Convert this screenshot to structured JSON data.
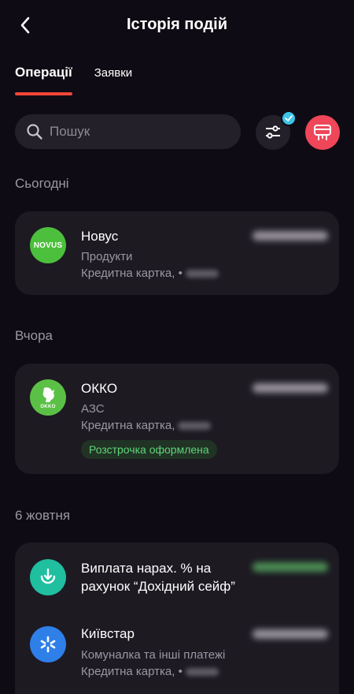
{
  "header": {
    "title": "Історія подій"
  },
  "tabs": [
    {
      "label": "Операції",
      "active": true
    },
    {
      "label": "Заявки",
      "active": false
    }
  ],
  "search": {
    "placeholder": "Пошук"
  },
  "colors": {
    "accent": "#f2473a",
    "background": "#0f0b14",
    "card": "#1d1a22",
    "check": "#3cc3e8",
    "report": "#ef4659",
    "success": "#5fd47a"
  },
  "sections": [
    {
      "label": "Сьогодні",
      "operations": [
        {
          "logo_text": "NOVUS",
          "title": "Новус",
          "category": "Продукти",
          "payment": "Кредитна картка, •",
          "logo_color": "#4cbf3c"
        }
      ]
    },
    {
      "label": "Вчора",
      "operations": [
        {
          "logo_text": "OKKO",
          "title": "ОККО",
          "category": "АЗС",
          "payment": "Кредитна картка,",
          "badge": "Розстрочка оформлена",
          "logo_color": "#5bc146"
        }
      ]
    },
    {
      "label": "6 жовтня",
      "operations": [
        {
          "title": "Виплата нарах. % на рахунок “Дохідний сейф”",
          "icon": "download-icon",
          "logo_color": "#1fbfa0"
        },
        {
          "title": "Київстар",
          "category": "Комуналка та інші платежі",
          "payment": "Кредитна картка, •",
          "icon": "kyivstar-icon",
          "logo_color": "#2f7fe8"
        }
      ]
    }
  ]
}
